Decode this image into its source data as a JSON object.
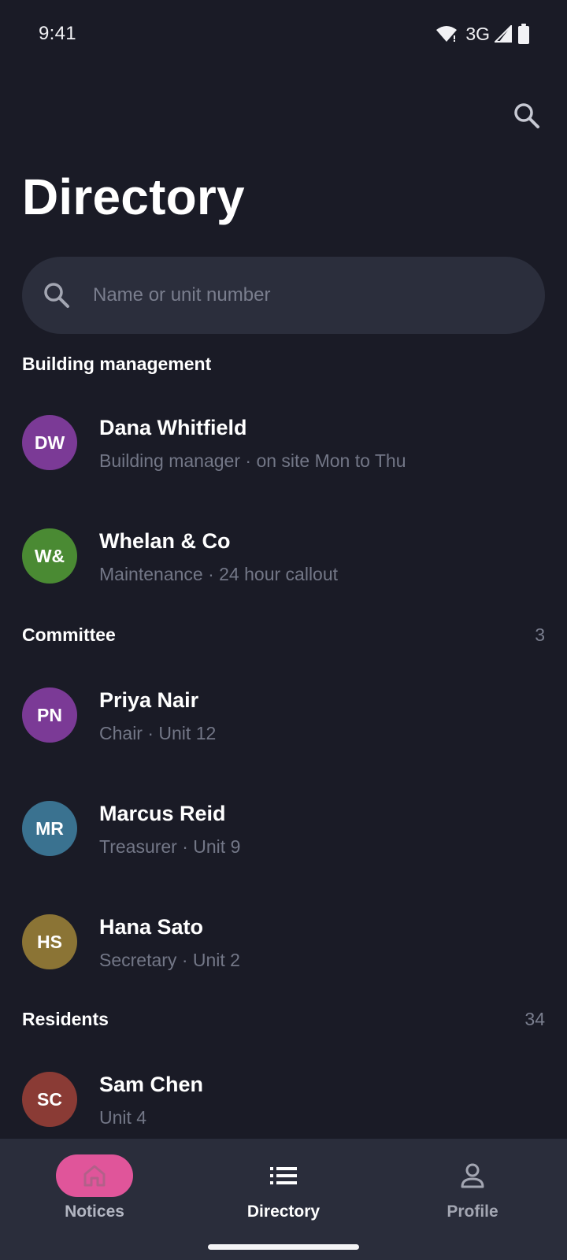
{
  "status_bar": {
    "time": "9:41",
    "network": "3G"
  },
  "header": {
    "title": "Directory"
  },
  "search": {
    "placeholder": "Name or unit number"
  },
  "sections": {
    "management": {
      "title": "Building management",
      "contacts": [
        {
          "initials": "DW",
          "name": "Dana Whitfield",
          "detail": "Building manager · on site Mon to Thu",
          "color": "#7b3a96"
        },
        {
          "initials": "W&",
          "name": "Whelan & Co",
          "detail": "Maintenance · 24 hour callout",
          "color": "#4a8a33"
        }
      ]
    },
    "committee": {
      "title": "Committee",
      "count": "3",
      "contacts": [
        {
          "initials": "PN",
          "name": "Priya Nair",
          "detail": "Chair · Unit 12",
          "color": "#7b3a96"
        },
        {
          "initials": "MR",
          "name": "Marcus Reid",
          "detail": "Treasurer · Unit 9",
          "color": "#3a7290"
        },
        {
          "initials": "HS",
          "name": "Hana Sato",
          "detail": "Secretary · Unit 2",
          "color": "#8b7435"
        }
      ]
    },
    "residents": {
      "title": "Residents",
      "count": "34",
      "contacts": [
        {
          "initials": "SC",
          "name": "Sam Chen",
          "detail": "Unit 4",
          "color": "#8a3b35"
        }
      ]
    }
  },
  "bottom_nav": {
    "items": [
      {
        "label": "Notices",
        "icon": "home-icon",
        "active_color": "#e0559a"
      },
      {
        "label": "Directory",
        "icon": "list-icon"
      },
      {
        "label": "Profile",
        "icon": "person-icon"
      }
    ]
  },
  "colors": {
    "background": "#1a1b26",
    "surface": "#2b2e3c",
    "nav_background": "#2a2d3b",
    "muted_text": "#737787",
    "accent": "#e0559a"
  }
}
